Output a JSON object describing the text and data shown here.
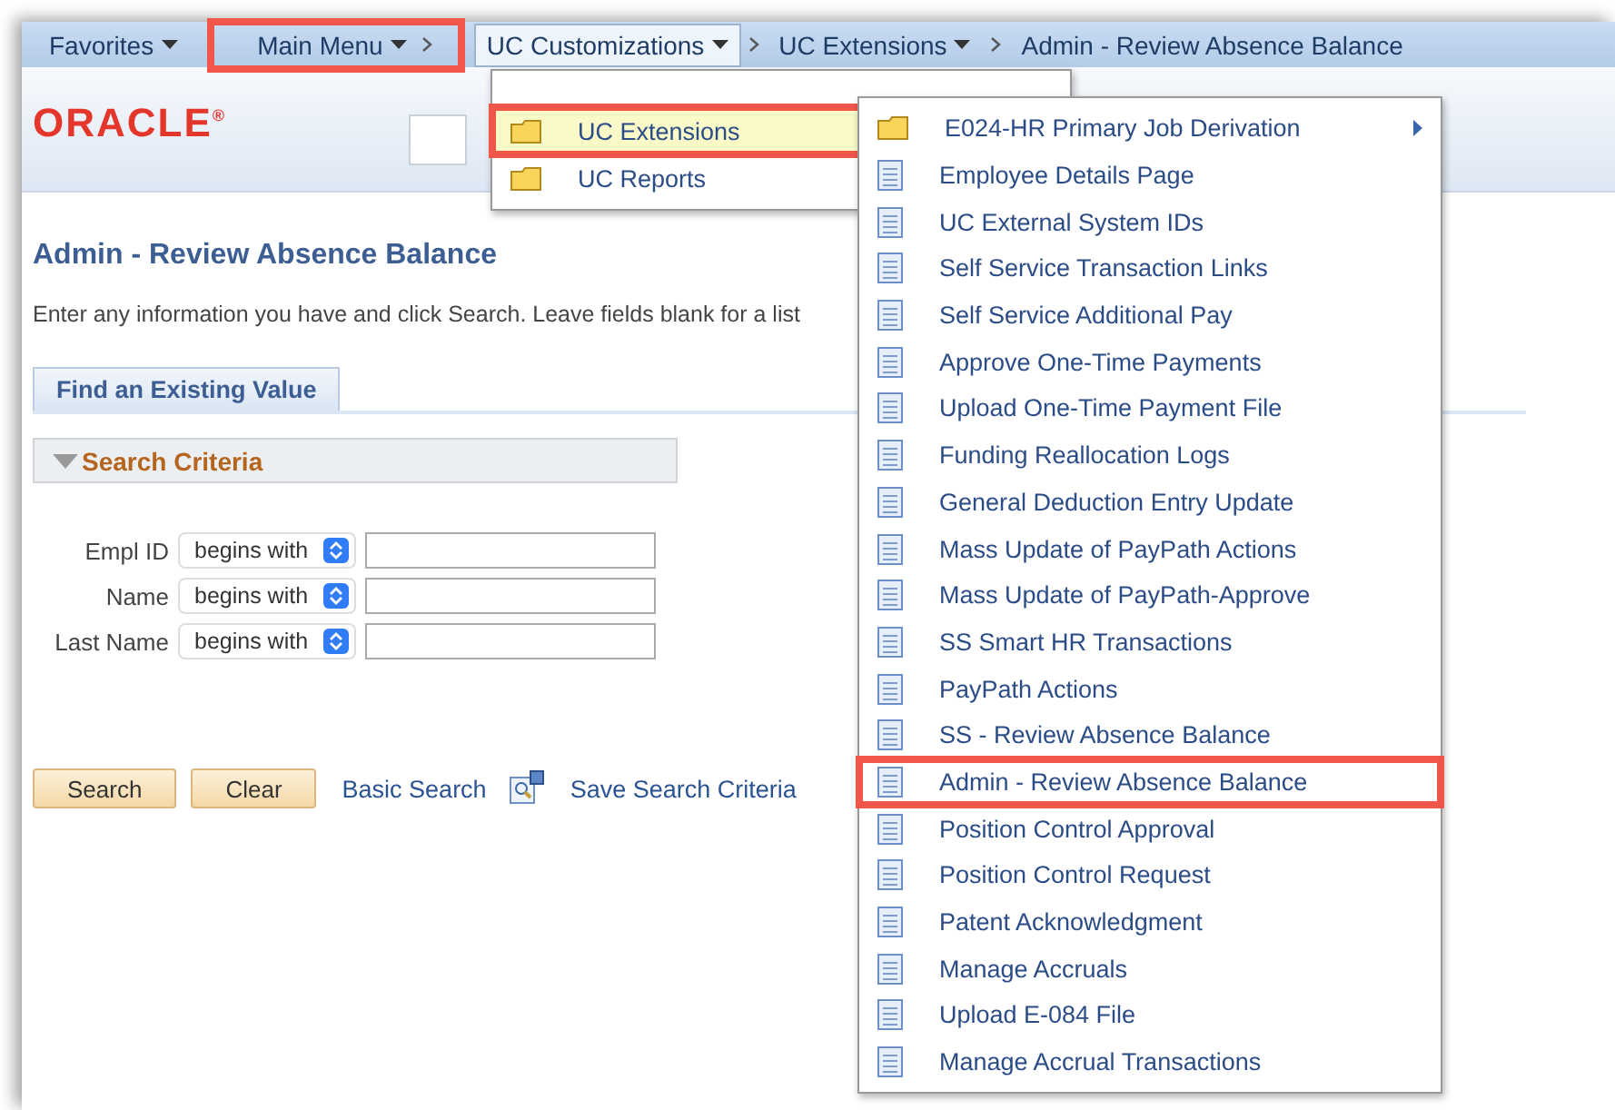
{
  "nav": [
    {
      "label": "Favorites",
      "kind": "menu",
      "highlighted": false,
      "selected": false
    },
    {
      "label": "Main Menu",
      "kind": "menu",
      "highlighted": true,
      "selected": false
    },
    {
      "label": "UC Customizations",
      "kind": "menu",
      "highlighted": false,
      "selected": true
    },
    {
      "label": "UC Extensions",
      "kind": "menu",
      "highlighted": false,
      "selected": false
    },
    {
      "label": "Admin - Review Absence Balance",
      "kind": "crumb",
      "highlighted": false,
      "selected": false
    }
  ],
  "logo": "ORACLE$^{®}$",
  "page": {
    "title": "Admin - Review Absence Balance",
    "instructions": "Enter any information you have and click Search. Leave fields blank for a list",
    "tabs": [
      {
        "label": "Find an Existing Value",
        "selected": true
      }
    ],
    "section": {
      "label": "Search Criteria",
      "expanded": true
    },
    "fields": [
      {
        "label": "Empl ID",
        "operator": "begins with"
      },
      {
        "label": "Name",
        "operator": "begins with"
      },
      {
        "label": "Last Name",
        "operator": "begins with"
      }
    ],
    "buttons": [
      "Search",
      "Clear"
    ],
    "links": [
      {
        "label": "Basic Search",
        "kind": "link"
      },
      {
        "label": "Save Search Criteria",
        "kind": "icon-link"
      }
    ]
  },
  "menu_1": [
    {
      "label": "UC Extensions",
      "kind": "folder",
      "selected": true,
      "highlighted": true
    },
    {
      "label": "UC Reports",
      "kind": "folder",
      "selected": false,
      "highlighted": false
    }
  ],
  "menu_2": [
    {
      "label": "E024-HR Primary Job Derivation",
      "kind": "folder",
      "highlighted": false
    },
    {
      "label": "Employee Details Page",
      "kind": "page",
      "highlighted": false
    },
    {
      "label": "UC External System IDs",
      "kind": "page",
      "highlighted": false
    },
    {
      "label": "Self Service Transaction Links",
      "kind": "page",
      "highlighted": false
    },
    {
      "label": "Self Service Additional Pay",
      "kind": "page",
      "highlighted": false
    },
    {
      "label": "Approve One-Time Payments",
      "kind": "page",
      "highlighted": false
    },
    {
      "label": "Upload One-Time Payment File",
      "kind": "page",
      "highlighted": false
    },
    {
      "label": "Funding Reallocation Logs",
      "kind": "page",
      "highlighted": false
    },
    {
      "label": "General Deduction Entry Update",
      "kind": "page",
      "highlighted": false
    },
    {
      "label": "Mass Update of PayPath Actions",
      "kind": "page",
      "highlighted": false
    },
    {
      "label": "Mass Update of PayPath-Approve",
      "kind": "page",
      "highlighted": false
    },
    {
      "label": "SS Smart HR Transactions",
      "kind": "page",
      "highlighted": false
    },
    {
      "label": "PayPath Actions",
      "kind": "page",
      "highlighted": false
    },
    {
      "label": "SS - Review Absence Balance",
      "kind": "page",
      "highlighted": false
    },
    {
      "label": "Admin - Review Absence Balance",
      "kind": "page",
      "highlighted": true
    },
    {
      "label": "Position Control Approval",
      "kind": "page",
      "highlighted": false
    },
    {
      "label": "Position Control Request",
      "kind": "page",
      "highlighted": false
    },
    {
      "label": "Patent Acknowledgment",
      "kind": "page",
      "highlighted": false
    },
    {
      "label": "Manage Accruals",
      "kind": "page",
      "highlighted": false
    },
    {
      "label": "Upload E-084 File",
      "kind": "page",
      "highlighted": false
    },
    {
      "label": "Manage Accrual Transactions",
      "kind": "page",
      "highlighted": false
    }
  ]
}
